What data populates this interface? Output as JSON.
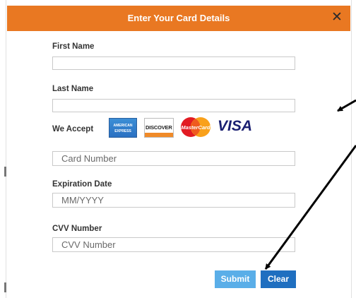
{
  "dialog": {
    "title": "Enter Your Card Details",
    "close_label": "✕"
  },
  "form": {
    "first_name": {
      "label": "First Name",
      "value": "",
      "placeholder": ""
    },
    "last_name": {
      "label": "Last Name",
      "value": "",
      "placeholder": ""
    },
    "we_accept": {
      "label": "We Accept",
      "cards": [
        {
          "name": "American Express",
          "icon": "amex-card-icon",
          "text": "AMERICAN EXPRESS"
        },
        {
          "name": "Discover",
          "icon": "discover-card-icon",
          "text": "DISCOVER"
        },
        {
          "name": "MasterCard",
          "icon": "mastercard-icon",
          "text": "MasterCard"
        },
        {
          "name": "Visa",
          "icon": "visa-card-icon",
          "text": "VISA"
        }
      ]
    },
    "card_number": {
      "label": "",
      "placeholder": "Card Number",
      "value": ""
    },
    "expiration_date": {
      "label": "Expiration Date",
      "placeholder": "MM/YYYY",
      "value": ""
    },
    "cvv": {
      "label": "CVV Number",
      "placeholder": "CVV Number",
      "value": ""
    }
  },
  "buttons": {
    "submit": "Submit",
    "clear": "Clear"
  },
  "colors": {
    "titlebar": "#e97822",
    "submit": "#5aaee8",
    "clear": "#1f6fc0"
  }
}
